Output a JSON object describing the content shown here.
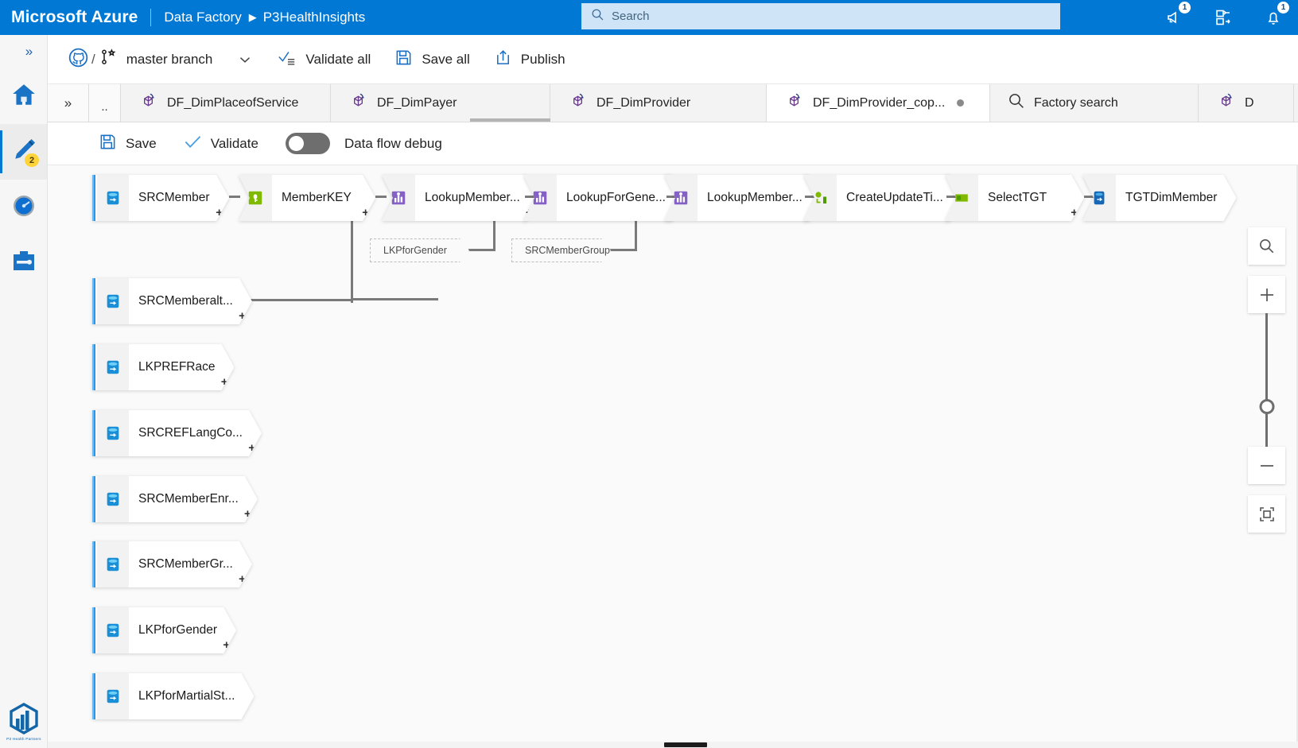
{
  "header": {
    "brand": "Microsoft Azure",
    "service": "Data Factory",
    "breadcrumb_separator": "▶",
    "factory_name": "P3HealthInsights",
    "search": {
      "placeholder": "Search",
      "value": "",
      "icon": "search-icon"
    },
    "actions": [
      {
        "name": "feedback-icon",
        "badge": "1"
      },
      {
        "name": "cloud-shell-icon",
        "badge": ""
      },
      {
        "name": "notifications-bell-icon",
        "badge": "1"
      }
    ]
  },
  "rail": {
    "expand_chevron": "»",
    "items": [
      {
        "name": "home-icon",
        "label": "Home",
        "badge": "",
        "active": false
      },
      {
        "name": "author-pencil-icon",
        "label": "Author",
        "badge": "2",
        "active": true
      },
      {
        "name": "monitor-gauge-icon",
        "label": "Monitor",
        "badge": "",
        "active": false
      },
      {
        "name": "manage-toolbox-icon",
        "label": "Manage",
        "badge": "",
        "active": false
      }
    ],
    "logo_caption": "P3 Health Partners"
  },
  "command_bar": {
    "git_icon": "github-icon",
    "separator": "/",
    "branch_icon": "branch-icon",
    "branch_label": "master branch",
    "branch_caret": "chevron-down-icon",
    "buttons": [
      {
        "name": "validate-all-button",
        "icon": "validate-icon",
        "label": "Validate all"
      },
      {
        "name": "save-all-button",
        "icon": "save-disk-icon",
        "label": "Save all"
      },
      {
        "name": "publish-button",
        "icon": "publish-upload-icon",
        "label": "Publish"
      }
    ]
  },
  "tabs": {
    "overflow_chevron": "»",
    "ellipsis": "..",
    "items": [
      {
        "label": "DF_DimPlaceofService",
        "icon": "dataflow-icon",
        "selected": false,
        "dirty": false
      },
      {
        "label": "DF_DimPayer",
        "icon": "dataflow-icon",
        "selected": false,
        "dirty": false
      },
      {
        "label": "DF_DimProvider",
        "icon": "dataflow-icon",
        "selected": false,
        "dirty": false
      },
      {
        "label": "DF_DimProvider_cop...",
        "icon": "dataflow-icon",
        "selected": true,
        "dirty": true
      },
      {
        "label": "Factory search",
        "icon": "search-icon",
        "selected": false,
        "dirty": false
      },
      {
        "label": "D",
        "icon": "dataflow-icon",
        "selected": false,
        "dirty": false
      }
    ]
  },
  "dataflow_toolbar": {
    "save": {
      "label": "Save",
      "icon": "save-disk-icon"
    },
    "validate": {
      "label": "Validate",
      "icon": "checkmark-icon"
    },
    "debug_toggle": {
      "label": "Data flow debug",
      "state": "off"
    }
  },
  "canvas": {
    "main_chain": [
      {
        "label": "SRCMember",
        "type": "source",
        "icon": "source-db-icon"
      },
      {
        "label": "MemberKEY",
        "type": "transform",
        "icon": "derived-column-icon"
      },
      {
        "label": "LookupMember...",
        "type": "transform",
        "icon": "lookup-icon"
      },
      {
        "label": "LookupForGene...",
        "type": "transform",
        "icon": "lookup-icon"
      },
      {
        "label": "LookupMember...",
        "type": "transform",
        "icon": "lookup-icon"
      },
      {
        "label": "CreateUpdateTi...",
        "type": "transform",
        "icon": "alter-row-icon"
      },
      {
        "label": "SelectTGT",
        "type": "transform",
        "icon": "select-icon"
      },
      {
        "label": "TGTDimMember",
        "type": "sink",
        "icon": "sink-db-icon"
      }
    ],
    "reference_nodes": [
      {
        "label": "LKPforGender"
      },
      {
        "label": "SRCMemberGroup"
      }
    ],
    "source_nodes": [
      {
        "label": "SRCMemberalt...",
        "icon": "source-db-icon"
      },
      {
        "label": "LKPREFRace",
        "icon": "source-db-icon"
      },
      {
        "label": "SRCREFLangCo...",
        "icon": "source-db-icon"
      },
      {
        "label": "SRCMemberEnr...",
        "icon": "source-db-icon"
      },
      {
        "label": "SRCMemberGr...",
        "icon": "source-db-icon"
      },
      {
        "label": "LKPforGender",
        "icon": "source-db-icon"
      },
      {
        "label": "LKPforMartialSt...",
        "icon": "source-db-icon"
      }
    ],
    "add_connector_glyph": "+"
  },
  "zoom_controls": {
    "search_canvas": {
      "name": "canvas-search-icon",
      "glyph": "⌕"
    },
    "zoom_in": {
      "name": "zoom-in-button",
      "glyph": "+"
    },
    "zoom_out": {
      "name": "zoom-out-button",
      "glyph": "−"
    },
    "fit_to_screen": {
      "name": "fit-to-screen-button"
    },
    "slider_value": 38
  },
  "colors": {
    "azure_blue": "#0078d4",
    "source_accent": "#2a97e8",
    "derived_column": "#7fba00",
    "lookup_purple": "#8661c5",
    "alter_row_green": "#7fba00",
    "badge_yellow": "#ffd43b"
  }
}
